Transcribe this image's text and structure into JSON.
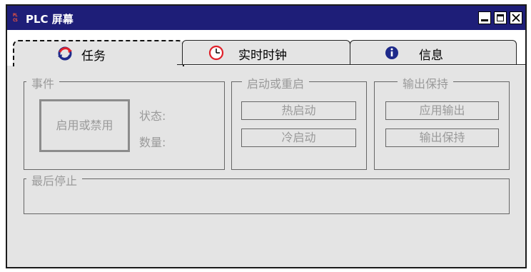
{
  "window": {
    "logo_text": "PLCS",
    "title": "PLC 屏幕",
    "buttons": [
      "minimize",
      "maximize",
      "close"
    ]
  },
  "tabs": [
    {
      "label": "任务",
      "icon": "sync-icon",
      "active": true
    },
    {
      "label": "实时时钟",
      "icon": "clock-icon",
      "active": false
    },
    {
      "label": "信息",
      "icon": "info-icon",
      "active": false
    }
  ],
  "events": {
    "title": "事件",
    "toggle_button": "启用或禁用",
    "status_label": "状态:",
    "count_label": "数量:"
  },
  "restart": {
    "title": "启动或重启",
    "warm_button": "热启动",
    "cold_button": "冷启动"
  },
  "output": {
    "title": "输出保持",
    "apply_button": "应用输出",
    "hold_button": "输出保持"
  },
  "last_stop": {
    "title": "最后停止"
  },
  "colors": {
    "titlebar": "#1e1e78",
    "panel": "#e4e4e4",
    "disabled_text": "#9a9a9a",
    "clock_red": "#e0202a",
    "info_navy": "#1e2a8a"
  }
}
